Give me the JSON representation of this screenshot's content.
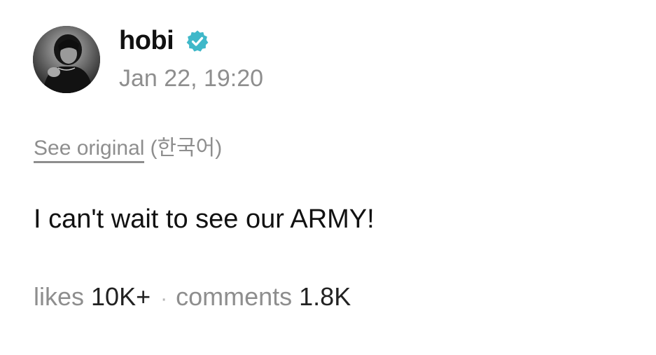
{
  "post": {
    "author": "hobi",
    "verified_icon": "verified-badge-icon",
    "timestamp": "Jan 22, 19:20",
    "see_original_label": "See original",
    "original_language": "(한국어)",
    "body_text": "I can't wait to see our ARMY!",
    "likes_label": "likes",
    "likes_count": "10K+",
    "separator": "·",
    "comments_label": "comments",
    "comments_count": "1.8K"
  },
  "colors": {
    "verified_badge": "#3fb8c9",
    "muted_text": "#8e8e8e",
    "primary_text": "#111111"
  }
}
